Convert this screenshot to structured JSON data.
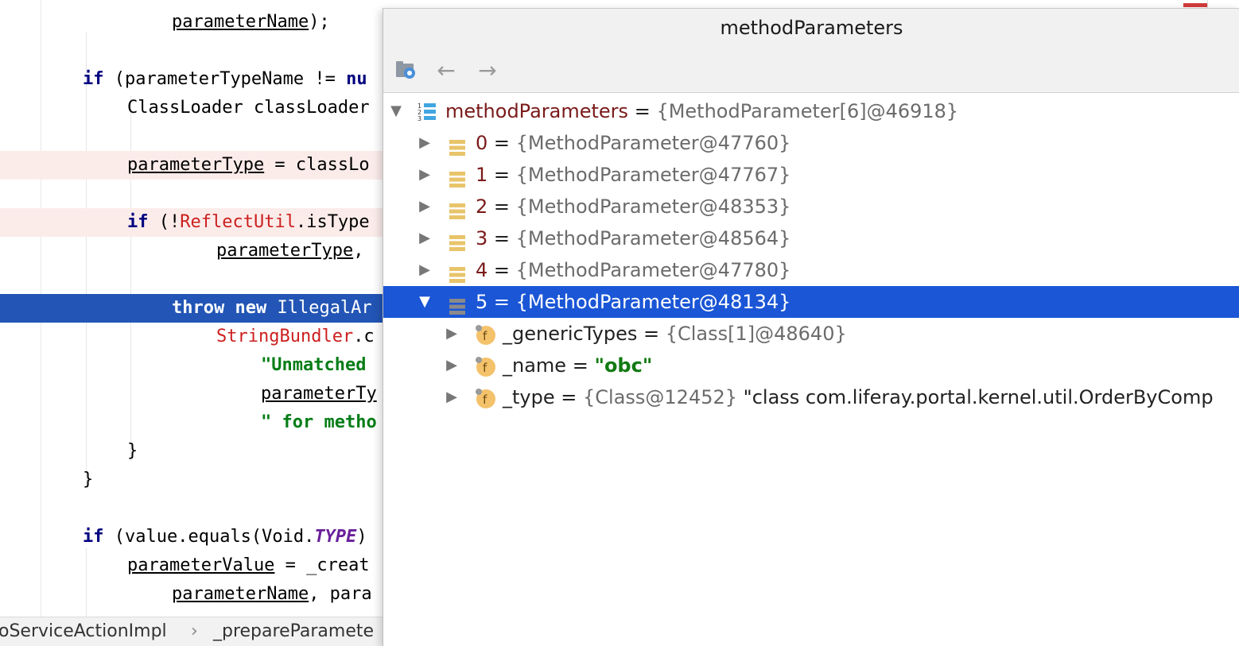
{
  "editor": {
    "lines": [
      {
        "id": "l1",
        "parts": [
          {
            "t": "parameterName",
            "u": true
          },
          {
            "t": ");"
          }
        ]
      },
      {
        "id": "l2",
        "parts": [
          {
            "t": "if",
            "k": "kw"
          },
          {
            "t": " (parameterTypeName != "
          },
          {
            "t": "nu",
            "k": "kw"
          }
        ]
      },
      {
        "id": "l3",
        "parts": [
          {
            "t": "ClassLoader classLoader"
          }
        ]
      },
      {
        "id": "l4",
        "parts": [
          {
            "t": "parameterType",
            "u": true
          },
          {
            "t": " = classLo"
          }
        ]
      },
      {
        "id": "l5",
        "parts": [
          {
            "t": "if",
            "k": "kw"
          },
          {
            "t": " (!"
          },
          {
            "t": "ReflectUtil",
            "k": "cls"
          },
          {
            "t": ".isType"
          }
        ]
      },
      {
        "id": "l6",
        "parts": [
          {
            "t": "parameterType",
            "u": true
          },
          {
            "t": ","
          }
        ]
      },
      {
        "id": "l7",
        "parts": [
          {
            "t": "throw new",
            "k": "kw"
          },
          {
            "t": " IllegalAr"
          }
        ]
      },
      {
        "id": "l8",
        "parts": [
          {
            "t": "StringBundler",
            "k": "cls"
          },
          {
            "t": ".c"
          }
        ]
      },
      {
        "id": "l9",
        "parts": [
          {
            "t": "\"Unmatched ",
            "k": "str"
          }
        ]
      },
      {
        "id": "l10",
        "parts": [
          {
            "t": "parameterTy",
            "u": true
          }
        ]
      },
      {
        "id": "l11",
        "parts": [
          {
            "t": "\" for metho",
            "k": "str"
          }
        ]
      },
      {
        "id": "l12",
        "parts": [
          {
            "t": "}"
          }
        ]
      },
      {
        "id": "l13",
        "parts": [
          {
            "t": "}"
          }
        ]
      },
      {
        "id": "l14",
        "parts": [
          {
            "t": "if",
            "k": "kw"
          },
          {
            "t": " (value.equals(Void."
          },
          {
            "t": "TYPE",
            "k": "const"
          },
          {
            "t": ")"
          }
        ]
      },
      {
        "id": "l15",
        "parts": [
          {
            "t": "parameterValue",
            "u": true
          },
          {
            "t": " = _creat"
          }
        ]
      },
      {
        "id": "l16",
        "parts": [
          {
            "t": "parameterName",
            "u": true
          },
          {
            "t": ", para"
          }
        ]
      }
    ]
  },
  "breadcrumb": {
    "class_name": "oServiceActionImpl",
    "separator": "›",
    "method_name": "_prepareParamete"
  },
  "popup": {
    "title": "methodParameters",
    "toolbar": {
      "back_glyph": "←",
      "forward_glyph": "→"
    },
    "root": {
      "name": "methodParameters",
      "eq": " = ",
      "value": "{MethodParameter[6]@46918}"
    },
    "items": [
      {
        "name": "0",
        "eq": " = ",
        "value": "{MethodParameter@47760}"
      },
      {
        "name": "1",
        "eq": " = ",
        "value": "{MethodParameter@47767}"
      },
      {
        "name": "2",
        "eq": " = ",
        "value": "{MethodParameter@48353}"
      },
      {
        "name": "3",
        "eq": " = ",
        "value": "{MethodParameter@48564}"
      },
      {
        "name": "4",
        "eq": " = ",
        "value": "{MethodParameter@47780}"
      },
      {
        "name": "5",
        "eq": " = ",
        "value": "{MethodParameter@48134}"
      }
    ],
    "fields": [
      {
        "name": "_genericTypes",
        "eq": " = ",
        "value": "{Class[1]@48640}",
        "extra": ""
      },
      {
        "name": "_name",
        "eq": " = ",
        "value": "\"obc\"",
        "extra": ""
      },
      {
        "name": "_type",
        "eq": " = ",
        "value": "{Class@12452}",
        "extra": " \"class com.liferay.portal.kernel.util.OrderByComp"
      }
    ],
    "field_icon_letter": "f",
    "colors": {
      "selection": "#1a56d6",
      "array_icon": "#e8c46a",
      "field_icon": "#f4c26b"
    }
  }
}
